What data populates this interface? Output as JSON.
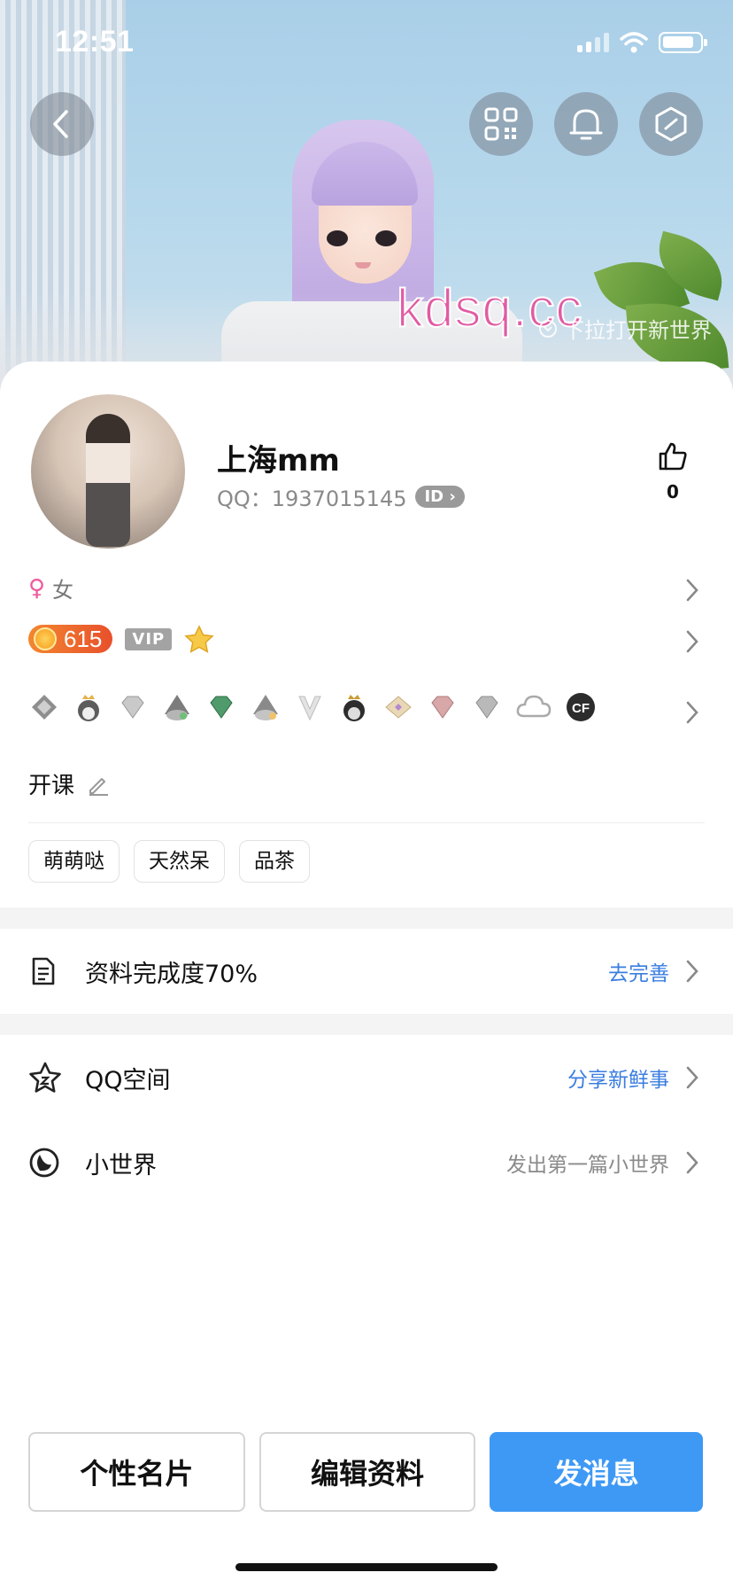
{
  "status_bar": {
    "time": "12:51"
  },
  "header": {
    "watermark": "kdsq.cc",
    "pull_hint": "下拉打开新世界",
    "icons": [
      "back-icon",
      "qr-code-icon",
      "bell-icon",
      "cube-icon"
    ]
  },
  "profile": {
    "nickname": "上海mm",
    "qq_label": "QQ：",
    "qq_number": "1937015145",
    "id_badge": "ID",
    "likes": "0",
    "gender": "女",
    "level_coins": "615",
    "vip_label": "VIP",
    "signature": "开课",
    "badges": [
      "crown-badge-icon",
      "penguin-crown-icon",
      "diamond-icon",
      "penguin-grey-icon",
      "diamond-green-icon",
      "penguin-hat-icon",
      "v-icon",
      "penguin-black-icon",
      "diamond-gold-icon",
      "diamond-red-icon",
      "diamond-silver-icon",
      "cloud-icon",
      "cf-game-icon"
    ],
    "tags": [
      "萌萌哒",
      "天然呆",
      "品茶"
    ]
  },
  "sections": {
    "completion": {
      "label": "资料完成度70%",
      "action": "去完善"
    },
    "qzone": {
      "label": "QQ空间",
      "action": "分享新鲜事"
    },
    "small_world": {
      "label": "小世界",
      "action": "发出第一篇小世界"
    }
  },
  "bottom_buttons": {
    "card": "个性名片",
    "edit": "编辑资料",
    "message": "发消息"
  },
  "colors": {
    "accent": "#3e99f5",
    "link": "#3a7de0",
    "female": "#ec5b9b",
    "coin": "#e8502c"
  }
}
